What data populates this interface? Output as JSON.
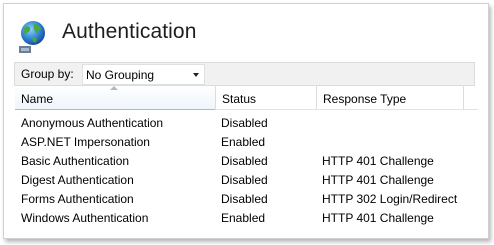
{
  "header": {
    "title": "Authentication",
    "icon": "globe-icon"
  },
  "toolbar": {
    "group_by_label": "Group by:",
    "group_by_value": "No Grouping"
  },
  "table": {
    "columns": [
      "Name",
      "Status",
      "Response Type"
    ],
    "sorted_column": "Name",
    "rows": [
      {
        "name": "Anonymous Authentication",
        "status": "Disabled",
        "response_type": ""
      },
      {
        "name": "ASP.NET Impersonation",
        "status": "Enabled",
        "response_type": ""
      },
      {
        "name": "Basic Authentication",
        "status": "Disabled",
        "response_type": "HTTP 401 Challenge"
      },
      {
        "name": "Digest Authentication",
        "status": "Disabled",
        "response_type": "HTTP 401 Challenge"
      },
      {
        "name": "Forms Authentication",
        "status": "Disabled",
        "response_type": "HTTP 302 Login/Redirect"
      },
      {
        "name": "Windows Authentication",
        "status": "Enabled",
        "response_type": "HTTP 401 Challenge"
      }
    ]
  },
  "colors": {
    "header_accent": "#9bbedc",
    "toolbar_bg": "#f1f1f1",
    "border": "#dcdcdc"
  }
}
